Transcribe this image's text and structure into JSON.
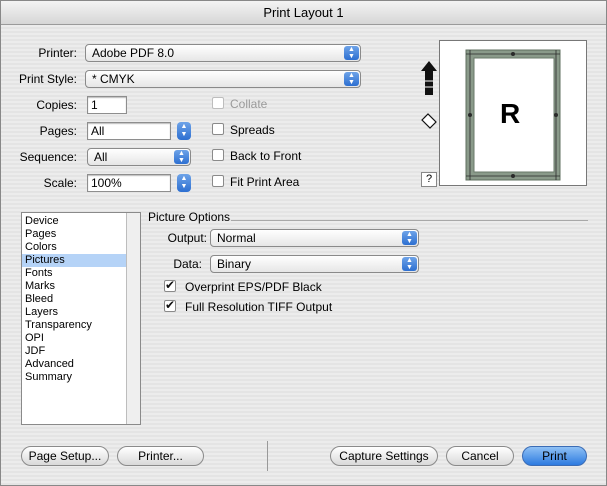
{
  "window": {
    "title": "Print Layout 1"
  },
  "labels": {
    "printer": "Printer:",
    "print_style": "Print Style:",
    "copies": "Copies:",
    "pages": "Pages:",
    "sequence": "Sequence:",
    "scale": "Scale:"
  },
  "values": {
    "printer": "Adobe PDF 8.0",
    "print_style": "* CMYK",
    "copies": "1",
    "pages": "All",
    "sequence": "All",
    "scale": "100%"
  },
  "checkboxes": {
    "collate": "Collate",
    "spreads": "Spreads",
    "back_to_front": "Back to Front",
    "fit_print_area": "Fit Print Area"
  },
  "preview": {
    "letter": "R",
    "help": "?"
  },
  "sidebar": {
    "items": [
      "Device",
      "Pages",
      "Colors",
      "Pictures",
      "Fonts",
      "Marks",
      "Bleed",
      "Layers",
      "Transparency",
      "OPI",
      "JDF",
      "Advanced",
      "Summary"
    ],
    "selected": "Pictures"
  },
  "picture_options": {
    "title": "Picture Options",
    "output_label": "Output:",
    "output_value": "Normal",
    "data_label": "Data:",
    "data_value": "Binary",
    "overprint": "Overprint EPS/PDF Black",
    "full_res": "Full Resolution TIFF Output"
  },
  "buttons": {
    "page_setup": "Page Setup...",
    "printer": "Printer...",
    "capture": "Capture Settings",
    "cancel": "Cancel",
    "print": "Print"
  },
  "colors": {
    "accent": "#2d6fd1",
    "selection": "#b5d3f7",
    "preview_border": "#8a9a8a"
  }
}
